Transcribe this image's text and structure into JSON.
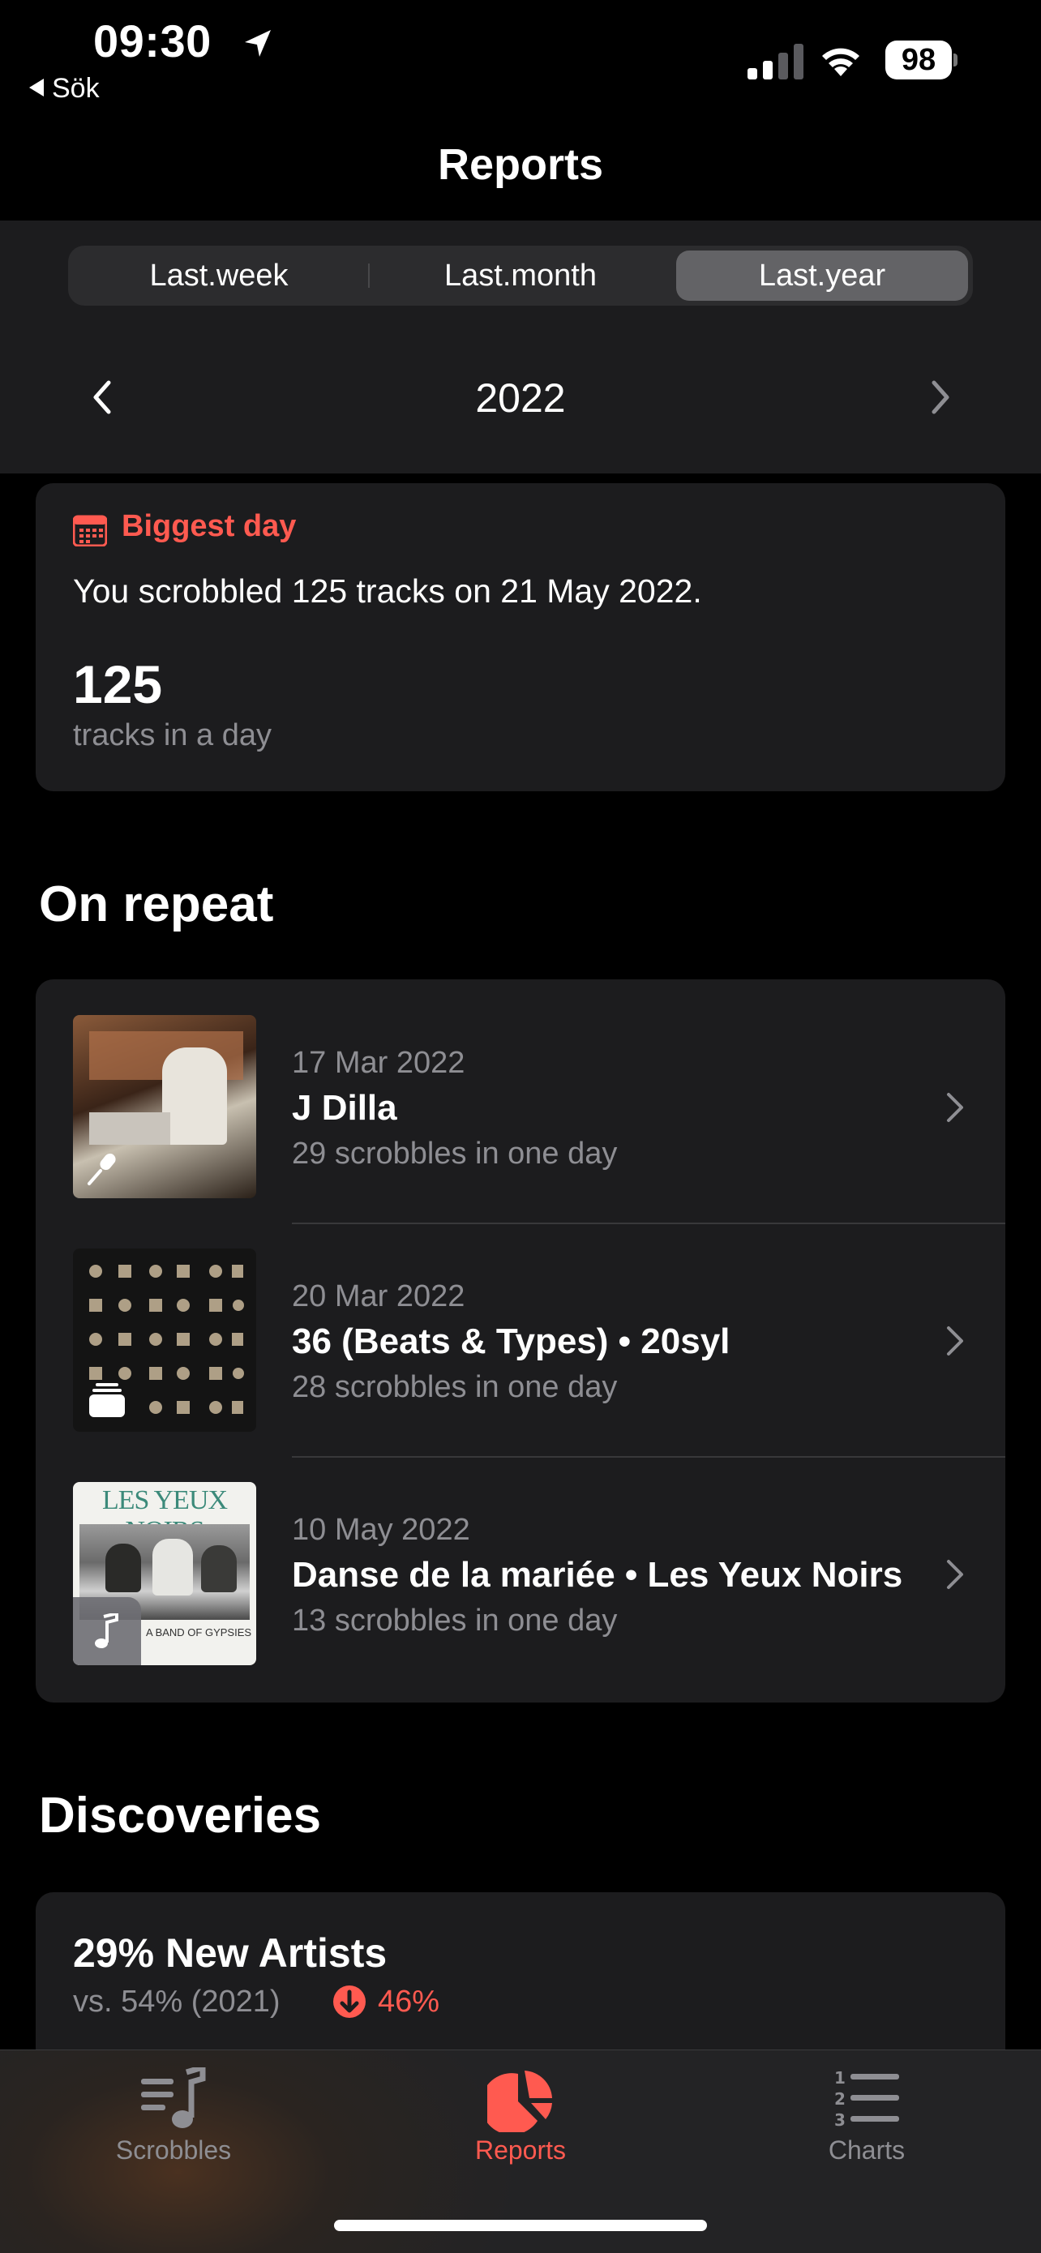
{
  "status_bar": {
    "time": "09:30",
    "back_label": "Sök",
    "battery": "98"
  },
  "nav": {
    "title": "Reports"
  },
  "segments": {
    "items": [
      "Last.week",
      "Last.month",
      "Last.year"
    ],
    "selected": "Last.year"
  },
  "period": {
    "label": "2022"
  },
  "biggest_day": {
    "heading": "Biggest day",
    "text": "You scrobbled 125 tracks on 21 May 2022.",
    "value": "125",
    "unit": "tracks in a day"
  },
  "on_repeat": {
    "title": "On repeat",
    "items": [
      {
        "date": "17 Mar 2022",
        "title": "J Dilla",
        "sub": "29 scrobbles in one day",
        "kind": "artist"
      },
      {
        "date": "20 Mar 2022",
        "title": "36 (Beats & Types) • 20syl",
        "sub": "28 scrobbles in one day",
        "kind": "album"
      },
      {
        "date": "10 May 2022",
        "title": "Danse de la mariée • Les Yeux Noirs",
        "sub": "13 scrobbles in one day",
        "kind": "track",
        "cover_text": "LES YEUX NOIRS",
        "cover_caption": "A BAND OF GYPSIES"
      }
    ]
  },
  "discoveries": {
    "title": "Discoveries",
    "headline": "29% New Artists",
    "comparison": "vs. 54% (2021)",
    "change": "46%"
  },
  "tabbar": {
    "items": [
      {
        "label": "Scrobbles",
        "icon": "music-note-list-icon"
      },
      {
        "label": "Reports",
        "icon": "pie-chart-icon"
      },
      {
        "label": "Charts",
        "icon": "numbered-list-icon"
      }
    ],
    "active": "Reports"
  },
  "colors": {
    "accent": "#ff5a50",
    "card": "#1c1c1e",
    "secondary_text": "#8e8e93"
  }
}
